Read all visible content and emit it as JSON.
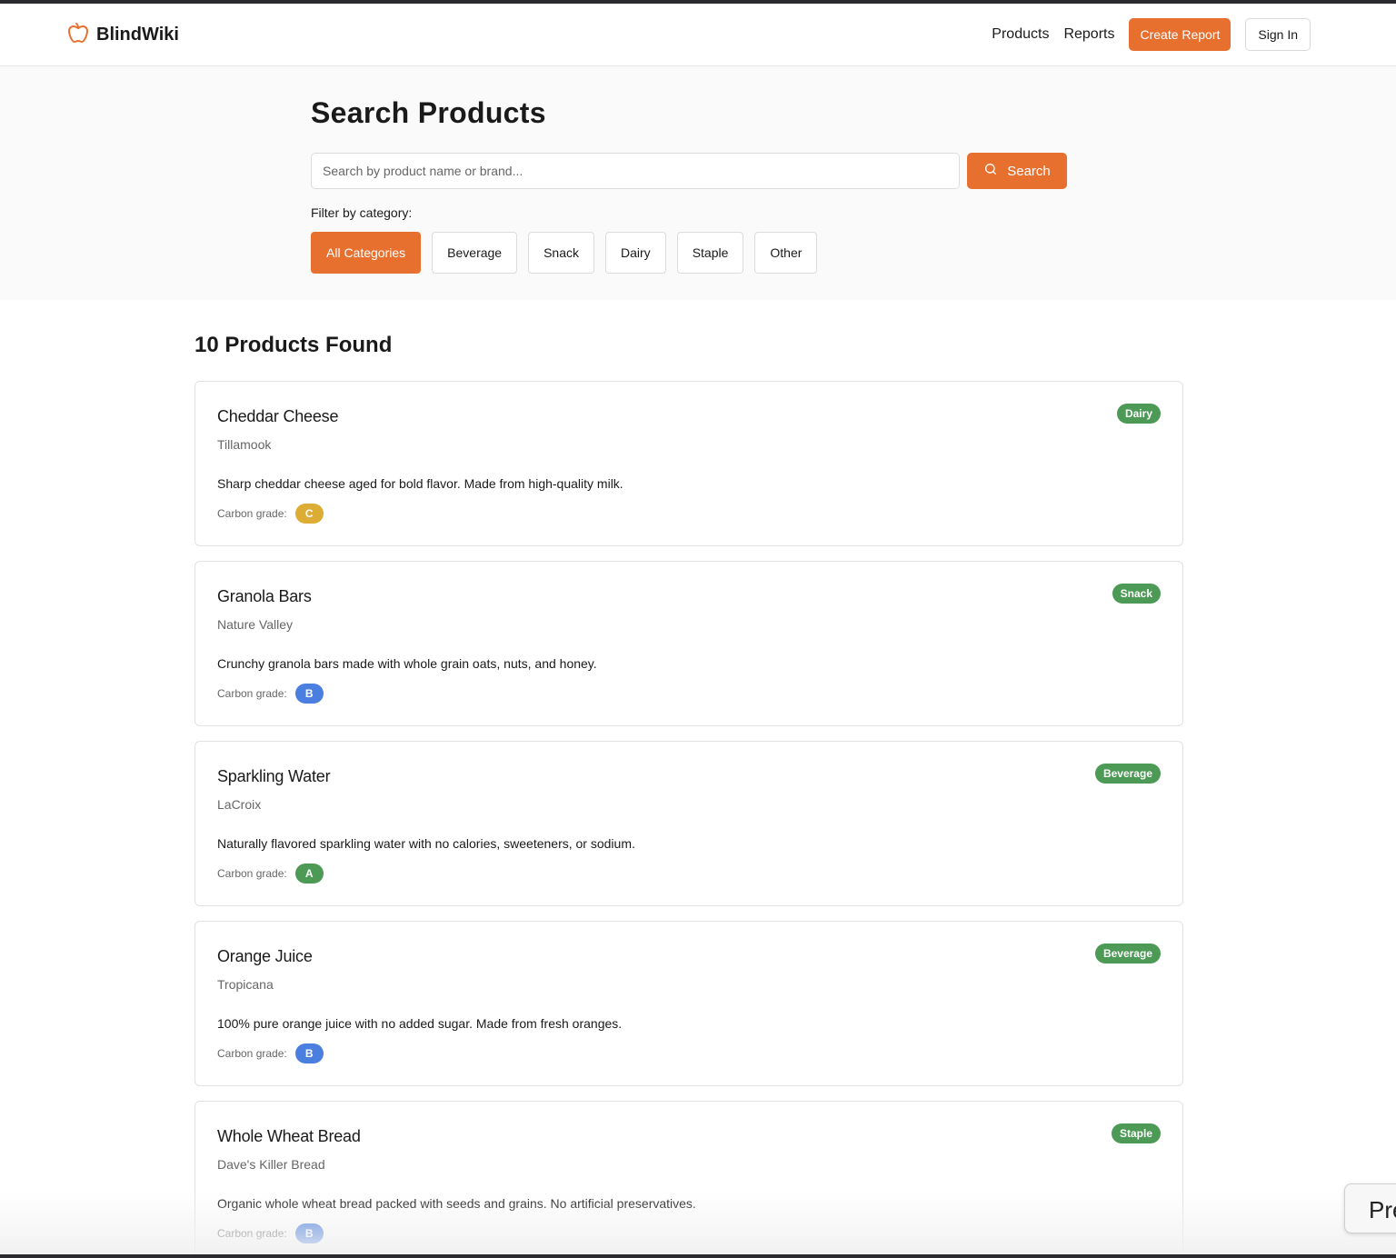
{
  "app": {
    "name": "BlindWiki",
    "logo_icon": "apple-icon"
  },
  "nav": {
    "products": "Products",
    "reports": "Reports",
    "create_report": "Create Report",
    "sign_in": "Sign In"
  },
  "search": {
    "title": "Search Products",
    "placeholder": "Search by product name or brand...",
    "button": "Search",
    "filter_label": "Filter by category:",
    "categories": [
      "All Categories",
      "Beverage",
      "Snack",
      "Dairy",
      "Staple",
      "Other"
    ],
    "active_category": "All Categories"
  },
  "results": {
    "title": "10 Products Found",
    "grade_label": "Carbon grade:",
    "products": [
      {
        "name": "Cheddar Cheese",
        "brand": "Tillamook",
        "description": "Sharp cheddar cheese aged for bold flavor. Made from high-quality milk.",
        "category": "Dairy",
        "grade": "C"
      },
      {
        "name": "Granola Bars",
        "brand": "Nature Valley",
        "description": "Crunchy granola bars made with whole grain oats, nuts, and honey.",
        "category": "Snack",
        "grade": "B"
      },
      {
        "name": "Sparkling Water",
        "brand": "LaCroix",
        "description": "Naturally flavored sparkling water with no calories, sweeteners, or sodium.",
        "category": "Beverage",
        "grade": "A"
      },
      {
        "name": "Orange Juice",
        "brand": "Tropicana",
        "description": "100% pure orange juice with no added sugar. Made from fresh oranges.",
        "category": "Beverage",
        "grade": "B"
      },
      {
        "name": "Whole Wheat Bread",
        "brand": "Dave's Killer Bread",
        "description": "Organic whole wheat bread packed with seeds and grains. No artificial preservatives.",
        "category": "Staple",
        "grade": "B"
      }
    ]
  },
  "colors": {
    "accent": "#e8702f",
    "category_badge": "#4c9a55",
    "grade_A": "#4c9a55",
    "grade_B": "#4a7fe0",
    "grade_C": "#dcac35"
  },
  "floating_tab": {
    "label": "Pre"
  }
}
